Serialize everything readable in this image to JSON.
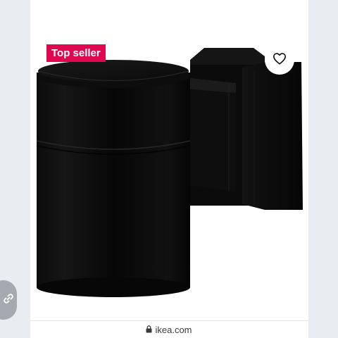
{
  "product": {
    "badge_label": "Top seller",
    "badge_color": "#e00751",
    "image_icon": "black-cylinder-wall-lamp"
  },
  "favorite": {
    "icon": "heart-outline-icon"
  },
  "side_tab": {
    "icon": "link-icon"
  },
  "browser": {
    "url": "ikea.com",
    "lock_icon": "lock-icon"
  }
}
